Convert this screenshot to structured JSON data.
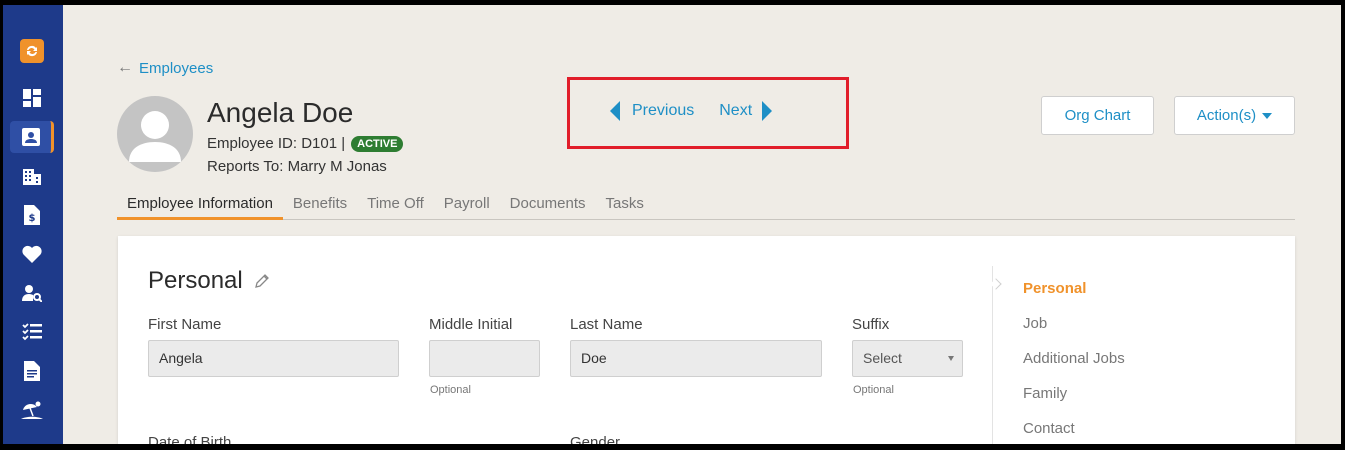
{
  "sidebar": {
    "items": [
      {
        "icon": "sync-icon"
      },
      {
        "icon": "dashboard-icon"
      },
      {
        "icon": "employee-card-icon",
        "active": true
      },
      {
        "icon": "building-icon"
      },
      {
        "icon": "document-dollar-icon"
      },
      {
        "icon": "heart-icon"
      },
      {
        "icon": "user-search-icon"
      },
      {
        "icon": "checklist-icon"
      },
      {
        "icon": "file-text-icon"
      },
      {
        "icon": "beach-umbrella-icon"
      }
    ]
  },
  "header": {
    "back_label": "Employees",
    "name": "Angela Doe",
    "employee_id_text": "Employee ID: D101 |",
    "status_badge": "ACTIVE",
    "reports_to": "Reports To: Marry M Jonas"
  },
  "pager": {
    "previous": "Previous",
    "next": "Next"
  },
  "actions": {
    "org_chart": "Org Chart",
    "actions": "Action(s)"
  },
  "tabs": [
    {
      "label": "Employee Information",
      "active": true
    },
    {
      "label": "Benefits"
    },
    {
      "label": "Time Off"
    },
    {
      "label": "Payroll"
    },
    {
      "label": "Documents"
    },
    {
      "label": "Tasks"
    }
  ],
  "personal": {
    "title": "Personal",
    "first_name": {
      "label": "First Name",
      "value": "Angela"
    },
    "middle_initial": {
      "label": "Middle Initial",
      "value": "",
      "hint": "Optional"
    },
    "last_name": {
      "label": "Last Name",
      "value": "Doe"
    },
    "suffix": {
      "label": "Suffix",
      "value": "Select",
      "hint": "Optional"
    },
    "dob_label": "Date of Birth",
    "gender_label": "Gender"
  },
  "section_nav": [
    {
      "label": "Personal",
      "active": true
    },
    {
      "label": "Job"
    },
    {
      "label": "Additional Jobs"
    },
    {
      "label": "Family"
    },
    {
      "label": "Contact"
    }
  ],
  "colors": {
    "accent": "#f0922b",
    "link": "#1e8fc6",
    "sidebar": "#1e3a8a",
    "highlight_box": "#e11d2a"
  }
}
